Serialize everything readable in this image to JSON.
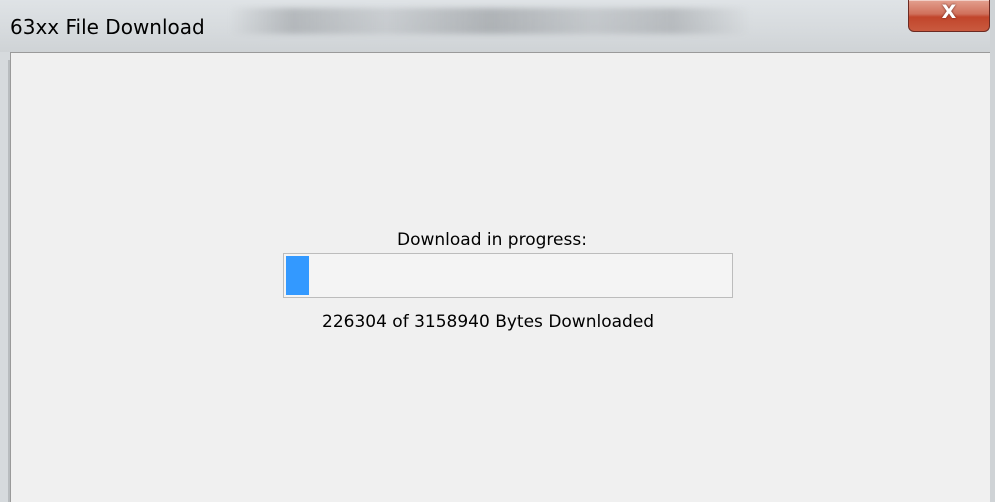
{
  "window": {
    "title": "63xx File Download",
    "close_glyph": "X"
  },
  "download": {
    "status_label": "Download in progress:",
    "bytes_label": "226304 of 3158940 Bytes Downloaded",
    "bytes_downloaded": 226304,
    "bytes_total": 3158940
  },
  "colors": {
    "progress_block": "#3399ff",
    "close_button": "#c1452b"
  },
  "icons": {
    "close": "close-icon"
  }
}
